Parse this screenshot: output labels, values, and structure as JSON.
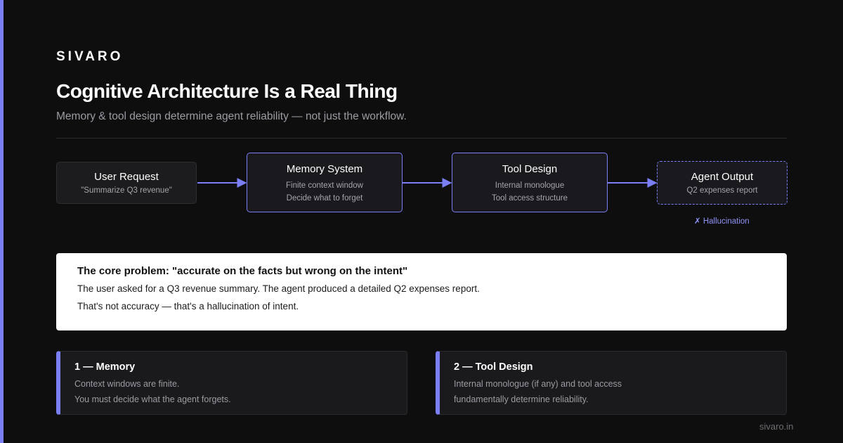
{
  "brand": "SIVARO",
  "title": "Cognitive Architecture Is a Real Thing",
  "subtitle": "Memory & tool design determine agent reliability — not just the workflow.",
  "flow": {
    "nodes": [
      {
        "title": "User Request",
        "lines": [
          "\"Summarize Q3 revenue\""
        ]
      },
      {
        "title": "Memory System",
        "lines": [
          "Finite context window",
          "Decide what to forget"
        ]
      },
      {
        "title": "Tool Design",
        "lines": [
          "Internal monologue",
          "Tool access structure"
        ]
      },
      {
        "title": "Agent Output",
        "lines": [
          "Q2 expenses report"
        ]
      }
    ],
    "output_flag": "✗ Hallucination"
  },
  "problem": {
    "heading": "The core problem: \"accurate on the facts but wrong on the intent\"",
    "line1": "The user asked for a Q3 revenue summary. The agent produced a detailed Q2 expenses report.",
    "line2": "That's not accuracy — that's a hallucination of intent."
  },
  "points": [
    {
      "title": "1 — Memory",
      "lines": [
        "Context windows are finite.",
        "You must decide what the agent forgets."
      ]
    },
    {
      "title": "2 — Tool Design",
      "lines": [
        "Internal monologue (if any) and tool access",
        "fundamentally determine reliability."
      ]
    }
  ],
  "footer": "sivaro.in",
  "colors": {
    "accent": "#7b7ff5",
    "background": "#0e0e0f"
  }
}
